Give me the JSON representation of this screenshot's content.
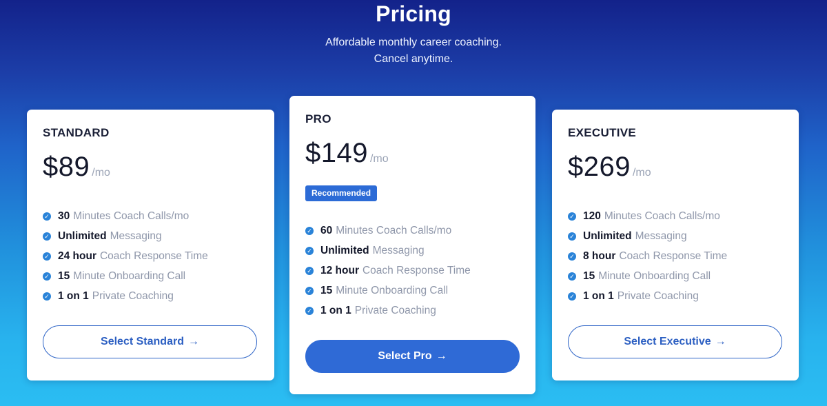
{
  "header": {
    "title": "Pricing",
    "subtitle_line1": "Affordable monthly career coaching.",
    "subtitle_line2": "Cancel anytime."
  },
  "colors": {
    "accent": "#2f6ad6",
    "background_top": "#13228a",
    "background_bottom": "#2bbdf2",
    "check": "#2a83d8"
  },
  "plans": [
    {
      "name": "STANDARD",
      "price": "$89",
      "period": "/mo",
      "features": [
        {
          "strong": "30",
          "rest": "Minutes Coach Calls/mo"
        },
        {
          "strong": "Unlimited",
          "rest": "Messaging"
        },
        {
          "strong": "24 hour",
          "rest": "Coach Response Time"
        },
        {
          "strong": "15",
          "rest": "Minute Onboarding Call"
        },
        {
          "strong": "1 on 1",
          "rest": "Private Coaching"
        }
      ],
      "button_label": "Select Standard",
      "button_icon": "arrow-right-icon"
    },
    {
      "name": "PRO",
      "price": "$149",
      "period": "/mo",
      "badge": "Recommended",
      "features": [
        {
          "strong": "60",
          "rest": "Minutes Coach Calls/mo"
        },
        {
          "strong": "Unlimited",
          "rest": "Messaging"
        },
        {
          "strong": "12 hour",
          "rest": "Coach Response Time"
        },
        {
          "strong": "15",
          "rest": "Minute Onboarding Call"
        },
        {
          "strong": "1 on 1",
          "rest": "Private Coaching"
        }
      ],
      "button_label": "Select Pro",
      "button_icon": "arrow-right-icon"
    },
    {
      "name": "EXECUTIVE",
      "price": "$269",
      "period": "/mo",
      "features": [
        {
          "strong": "120",
          "rest": "Minutes Coach Calls/mo"
        },
        {
          "strong": "Unlimited",
          "rest": "Messaging"
        },
        {
          "strong": "8 hour",
          "rest": "Coach Response Time"
        },
        {
          "strong": "15",
          "rest": "Minute Onboarding Call"
        },
        {
          "strong": "1 on 1",
          "rest": "Private Coaching"
        }
      ],
      "button_label": "Select Executive",
      "button_icon": "arrow-right-icon"
    }
  ],
  "icons": {
    "check": "check-circle-icon",
    "arrow": "arrow-right-icon"
  }
}
